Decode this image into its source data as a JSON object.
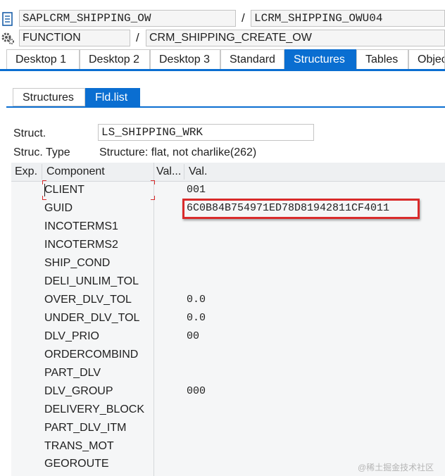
{
  "header": {
    "program": "SAPLCRM_SHIPPING_OW",
    "include": "LCRM_SHIPPING_OWU04",
    "event_type": "FUNCTION",
    "event_name": "CRM_SHIPPING_CREATE_OW",
    "separator": "/"
  },
  "tabs": [
    {
      "label": "Desktop 1"
    },
    {
      "label": "Desktop 2"
    },
    {
      "label": "Desktop 3"
    },
    {
      "label": "Standard"
    },
    {
      "label": "Structures"
    },
    {
      "label": "Tables"
    },
    {
      "label": "Objec"
    }
  ],
  "subtabs": [
    {
      "label": "Structures"
    },
    {
      "label": "Fld.list"
    }
  ],
  "struct": {
    "label": "Struct.",
    "value": "LS_SHIPPING_WRK",
    "type_label": "Struc. Type",
    "type_value": "Structure: flat, not charlike(262)"
  },
  "grid": {
    "col_exp": "Exp.",
    "col_component": "Component",
    "col_valtype": "Val...",
    "col_val": "Val.",
    "rows": [
      {
        "component": "CLIENT",
        "value": "001"
      },
      {
        "component": "GUID",
        "value": "6C0B84B754971ED78D81942811CF4011"
      },
      {
        "component": "INCOTERMS1",
        "value": ""
      },
      {
        "component": "INCOTERMS2",
        "value": ""
      },
      {
        "component": "SHIP_COND",
        "value": ""
      },
      {
        "component": "DELI_UNLIM_TOL",
        "value": ""
      },
      {
        "component": "OVER_DLV_TOL",
        "value": "0.0"
      },
      {
        "component": "UNDER_DLV_TOL",
        "value": "0.0"
      },
      {
        "component": "DLV_PRIO",
        "value": "00"
      },
      {
        "component": "ORDERCOMBIND",
        "value": ""
      },
      {
        "component": "PART_DLV",
        "value": ""
      },
      {
        "component": "DLV_GROUP",
        "value": "000"
      },
      {
        "component": "DELIVERY_BLOCK",
        "value": ""
      },
      {
        "component": "PART_DLV_ITM",
        "value": ""
      },
      {
        "component": "TRANS_MOT",
        "value": ""
      },
      {
        "component": "GEOROUTE",
        "value": ""
      }
    ]
  },
  "watermark": "@稀土掘金技术社区",
  "colors": {
    "accent": "#0a6ed1",
    "highlight": "#d92b2b"
  }
}
